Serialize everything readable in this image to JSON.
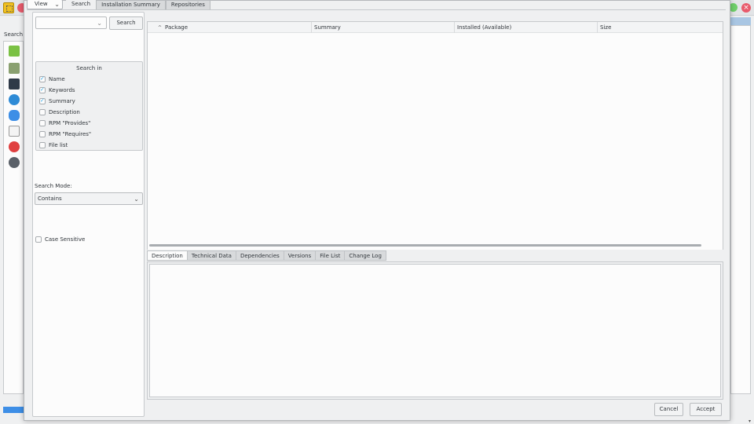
{
  "background": {
    "search_label": "Search",
    "close_glyph": "×"
  },
  "top_bar": {
    "view_label": "View",
    "tabs": [
      {
        "label": "Search",
        "active": true
      },
      {
        "label": "Installation Summary",
        "active": false
      },
      {
        "label": "Repositories",
        "active": false
      }
    ]
  },
  "search": {
    "query_value": "",
    "button_label": "Search"
  },
  "search_in": {
    "title": "Search in",
    "options": [
      {
        "label": "Name",
        "checked": true
      },
      {
        "label": "Keywords",
        "checked": true
      },
      {
        "label": "Summary",
        "checked": true
      },
      {
        "label": "Description",
        "checked": false
      },
      {
        "label": "RPM \"Provides\"",
        "checked": false
      },
      {
        "label": "RPM \"Requires\"",
        "checked": false
      },
      {
        "label": "File list",
        "checked": false
      }
    ]
  },
  "search_mode": {
    "label": "Search Mode:",
    "value": "Contains"
  },
  "case_sensitive": {
    "label": "Case Sensitive",
    "checked": false
  },
  "table": {
    "columns": [
      "Package",
      "Summary",
      "Installed (Available)",
      "Size"
    ],
    "rows": []
  },
  "detail_tabs": [
    {
      "label": "Description",
      "active": true
    },
    {
      "label": "Technical Data",
      "active": false
    },
    {
      "label": "Dependencies",
      "active": false
    },
    {
      "label": "Versions",
      "active": false
    },
    {
      "label": "File List",
      "active": false
    },
    {
      "label": "Change Log",
      "active": false
    }
  ],
  "footer": {
    "cancel_label": "Cancel",
    "accept_label": "Accept"
  },
  "colors": {
    "accent": "#3daee9",
    "window_bg": "#eff0f1",
    "view_bg": "#fcfcfc"
  }
}
